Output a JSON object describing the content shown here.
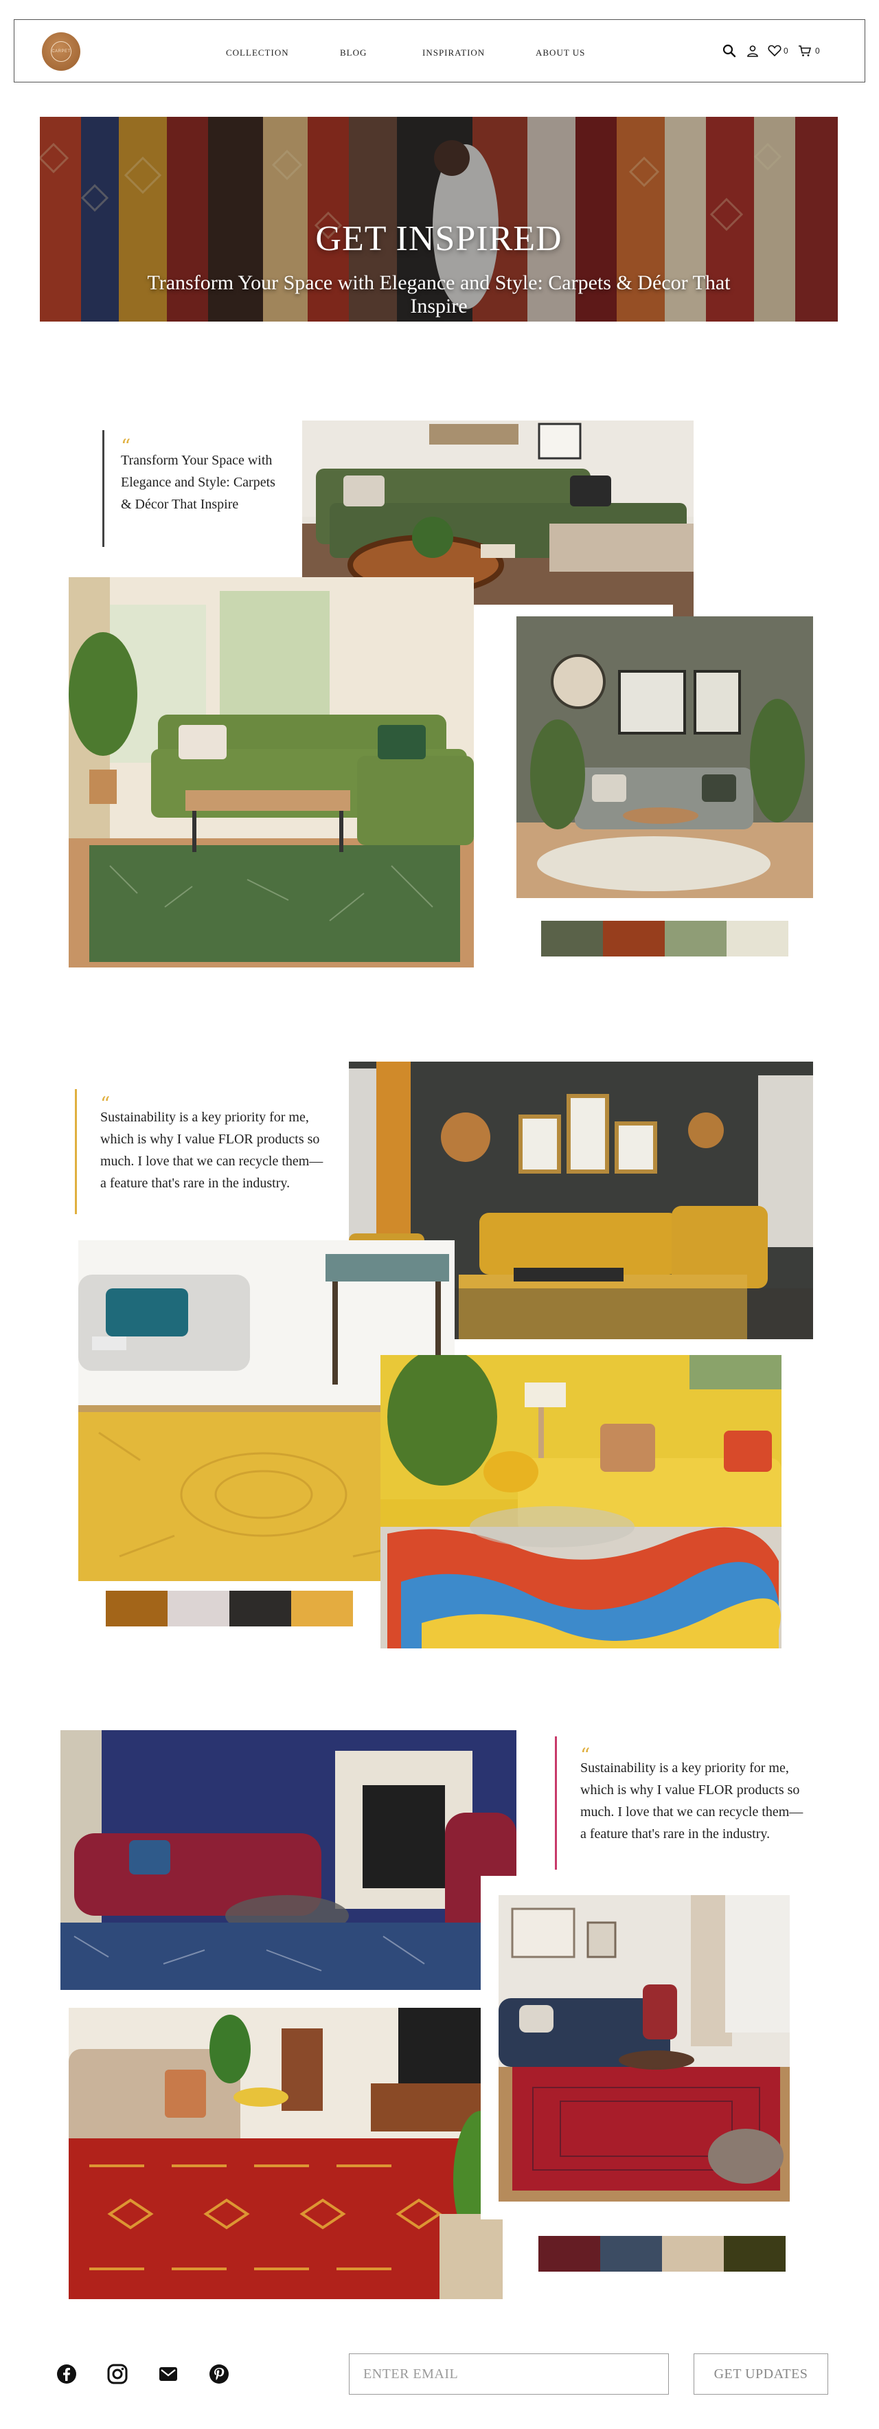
{
  "header": {
    "logo_text": "CARPET",
    "nav": [
      "COLLECTION",
      "BLOG",
      "INSPIRATION",
      "ABOUT US"
    ],
    "wishlist_count": "0",
    "cart_count": "0"
  },
  "hero": {
    "title": "GET INSPIRED",
    "subtitle": "Transform Your Space with Elegance and Style: Carpets & Décor That Inspire"
  },
  "sections": [
    {
      "quote": "Transform Your Space with Elegance and Style:  Carpets & Décor That Inspire",
      "accent": "#444444",
      "palette": [
        "#5a6249",
        "#973e1d",
        "#8f9d76",
        "#e6e3d3"
      ]
    },
    {
      "quote": "Sustainability is a key priority for me, which is why I value FLOR products so much. I love that we can recycle them—a feature that's rare in the industry.",
      "accent": "#e0b040",
      "palette": [
        "#a36519",
        "#dcd4d3",
        "#2d2b29",
        "#e4ac40"
      ]
    },
    {
      "quote": "Sustainability is a key priority for me, which is why I value FLOR products so much. I love that we can recycle them—a feature that's rare in the industry.",
      "accent": "#c83a6a",
      "palette": [
        "#651d24",
        "#3c4c63",
        "#d3c1a6",
        "#3c3c17"
      ]
    }
  ],
  "footer": {
    "social": [
      "facebook-icon",
      "instagram-icon",
      "mail-icon",
      "pinterest-icon"
    ],
    "email_placeholder": "ENTER EMAIL",
    "button_label": "GET UPDATES"
  }
}
